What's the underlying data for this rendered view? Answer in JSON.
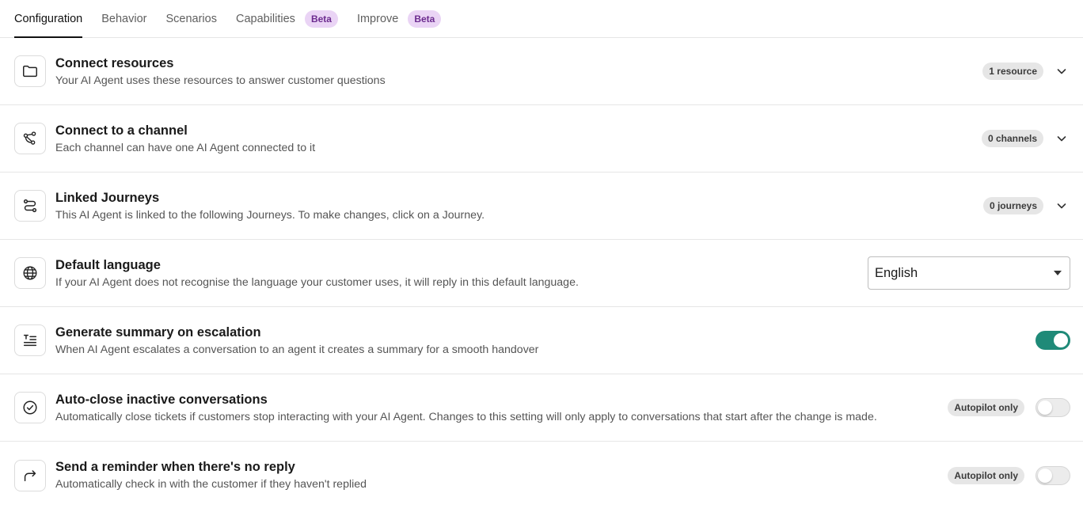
{
  "tabs": [
    {
      "label": "Configuration",
      "badge": ""
    },
    {
      "label": "Behavior",
      "badge": ""
    },
    {
      "label": "Scenarios",
      "badge": ""
    },
    {
      "label": "Capabilities",
      "badge": "Beta"
    },
    {
      "label": "Improve",
      "badge": "Beta"
    }
  ],
  "rows": {
    "resources": {
      "icon": "folder-icon",
      "title": "Connect resources",
      "desc": "Your AI Agent uses these resources to answer customer questions",
      "pill": "1 resource"
    },
    "channel": {
      "icon": "channel-nodes-icon",
      "title": "Connect to a channel",
      "desc": "Each channel can have one AI Agent connected to it",
      "pill": "0 channels"
    },
    "journeys": {
      "icon": "journey-route-icon",
      "title": "Linked Journeys",
      "desc": "This AI Agent is linked to the following Journeys. To make changes, click on a Journey.",
      "pill": "0 journeys"
    },
    "language": {
      "icon": "globe-icon",
      "title": "Default language",
      "desc": "If your AI Agent does not recognise the language your customer uses, it will reply in this default language.",
      "select_value": "English"
    },
    "summary": {
      "icon": "list-summary-icon",
      "title": "Generate summary on escalation",
      "desc": "When AI Agent escalates a conversation to an agent it creates a summary for a smooth handover",
      "enabled": true
    },
    "autoclose": {
      "icon": "check-circle-icon",
      "title": "Auto-close inactive conversations",
      "desc": "Automatically close tickets if customers stop interacting with your AI Agent. Changes to this setting will only apply to conversations that start after the change is made.",
      "pill": "Autopilot only",
      "enabled": false
    },
    "reminder": {
      "icon": "redo-arrow-icon",
      "title": "Send a reminder when there's no reply",
      "desc": "Automatically check in with the customer if they haven't replied",
      "pill": "Autopilot only",
      "enabled": false
    }
  },
  "colors": {
    "accent": "#1f8a78",
    "beta_bg": "#ead4f5",
    "beta_text": "#6c2b8f",
    "pill_bg": "#e6e6e6"
  }
}
